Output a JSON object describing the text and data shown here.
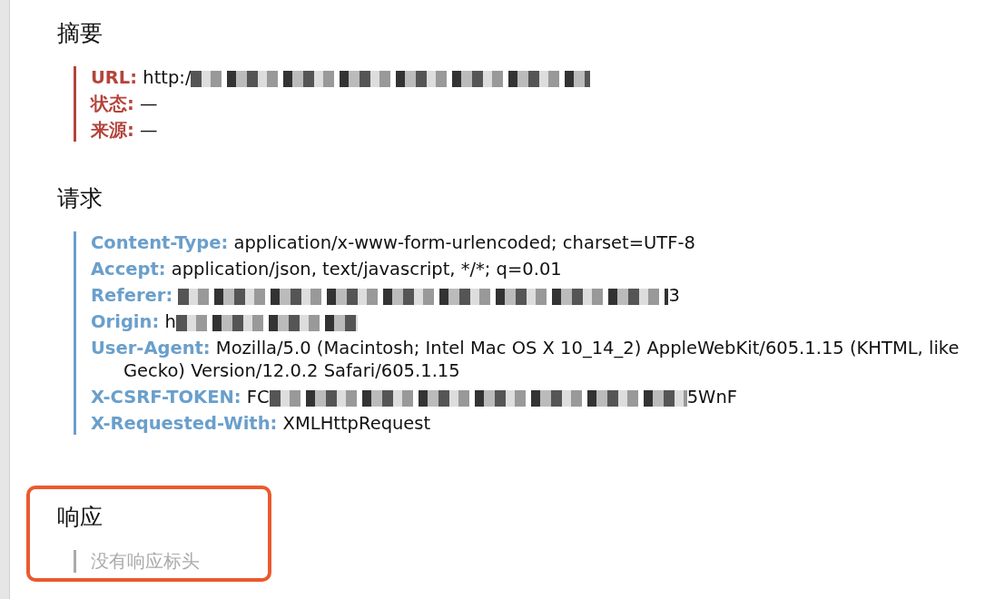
{
  "sections": [
    {
      "kind": "summary",
      "title": "摘要",
      "highlighted": false,
      "headers": [
        {
          "name": "URL:",
          "value": "http:/",
          "redacted": true
        },
        {
          "name": "状态:",
          "value": "—",
          "redacted": false
        },
        {
          "name": "来源:",
          "value": "—",
          "redacted": false
        }
      ]
    },
    {
      "kind": "request",
      "title": "请求",
      "highlighted": false,
      "headers": [
        {
          "name": "Content-Type:",
          "value": "application/x-www-form-urlencoded; charset=UTF-8",
          "redacted": false
        },
        {
          "name": "Accept:",
          "value": "application/json, text/javascript, */*; q=0.01",
          "redacted": false
        },
        {
          "name": "Referer:",
          "redacted": true,
          "suffix": "3"
        },
        {
          "name": "Origin:",
          "value": "h",
          "redacted": true
        },
        {
          "name": "User-Agent:",
          "value": "Mozilla/5.0 (Macintosh; Intel Mac OS X 10_14_2) AppleWebKit/605.1.15 (KHTML, like Gecko) Version/12.0.2 Safari/605.1.15",
          "redacted": false
        },
        {
          "name": "X-CSRF-TOKEN:",
          "value": "FC",
          "redacted": true,
          "suffix": "5WnF"
        },
        {
          "name": "X-Requested-With:",
          "value": "XMLHttpRequest",
          "redacted": false
        }
      ]
    },
    {
      "kind": "response",
      "title": "响应",
      "highlighted": true,
      "empty_text": "没有响应标头"
    }
  ]
}
